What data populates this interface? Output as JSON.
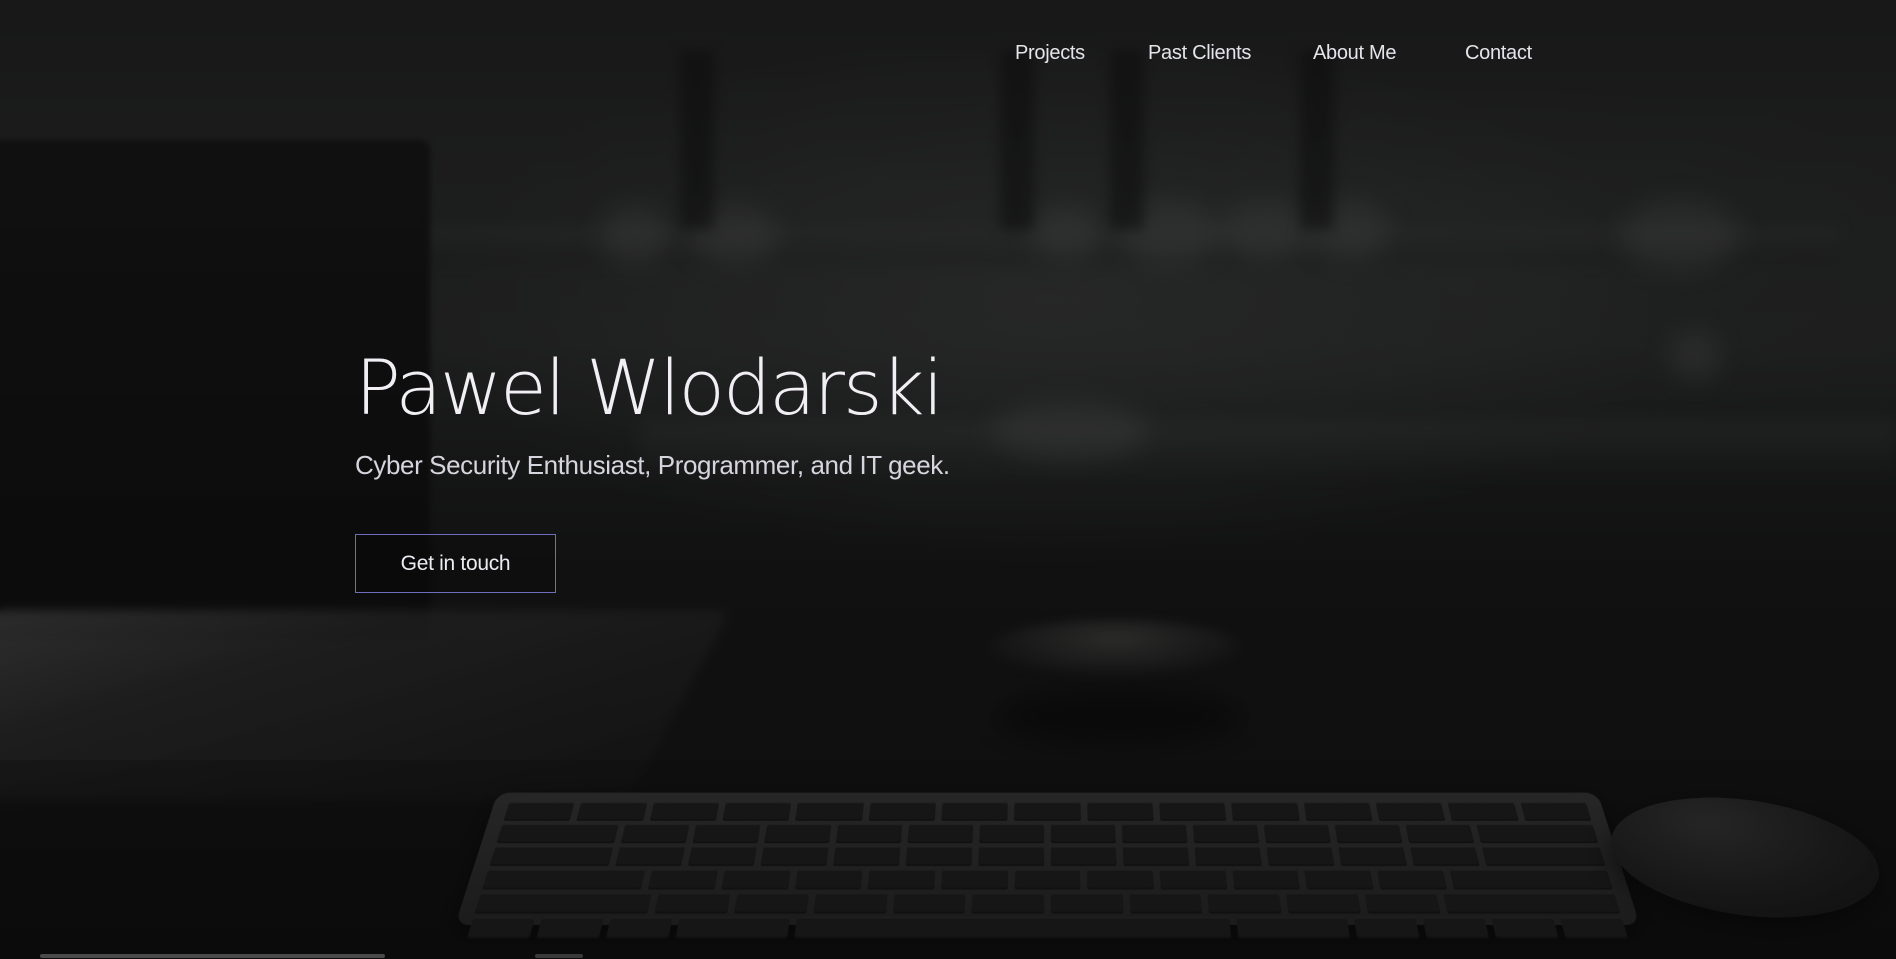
{
  "nav": {
    "items": [
      {
        "label": "Projects"
      },
      {
        "label": "Past Clients"
      },
      {
        "label": "About Me"
      },
      {
        "label": "Contact"
      }
    ]
  },
  "hero": {
    "title": "Pawel Wlodarski",
    "subtitle": "Cyber Security Enthusiast, Programmer, and IT geek.",
    "cta_label": "Get in touch"
  },
  "theme": {
    "cta_border": "#6e6ec0",
    "text": "#f1eef4",
    "overlay": "#0a0a0c"
  }
}
